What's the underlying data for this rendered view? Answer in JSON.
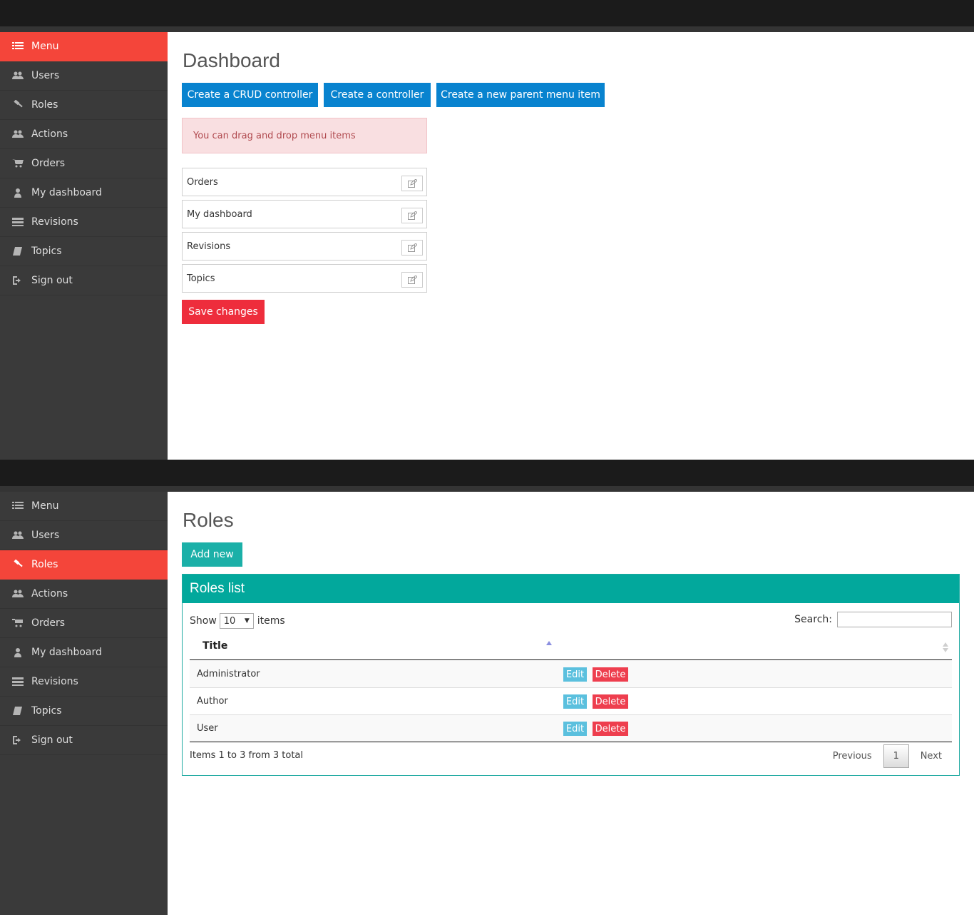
{
  "sidebar": {
    "items": [
      {
        "label": "Menu",
        "icon": "list-icon"
      },
      {
        "label": "Users",
        "icon": "users-icon"
      },
      {
        "label": "Roles",
        "icon": "gavel-icon"
      },
      {
        "label": "Actions",
        "icon": "users-icon"
      },
      {
        "label": "Orders",
        "icon": "cart-icon"
      },
      {
        "label": "My dashboard",
        "icon": "user-icon"
      },
      {
        "label": "Revisions",
        "icon": "tasks-icon"
      },
      {
        "label": "Topics",
        "icon": "book-icon"
      },
      {
        "label": "Sign out",
        "icon": "sign-out-icon"
      }
    ],
    "active_color": "#f4453a",
    "background": "#3a3a3a"
  },
  "dashboard": {
    "title": "Dashboard",
    "buttons": {
      "crud": "Create a CRUD controller",
      "controller": "Create a controller",
      "parent_menu": "Create a new parent menu item"
    },
    "alert": "You can drag and drop menu items",
    "menu_items": [
      "Orders",
      "My dashboard",
      "Revisions",
      "Topics"
    ],
    "save_label": "Save changes"
  },
  "roles": {
    "title": "Roles",
    "add_new": "Add new",
    "list_title": "Roles list",
    "show_label": "Show",
    "show_value": "10",
    "items_label": "items",
    "search_label": "Search:",
    "column_title": "Title",
    "rows": [
      {
        "title": "Administrator",
        "edit": "Edit",
        "delete": "Delete"
      },
      {
        "title": "Author",
        "edit": "Edit",
        "delete": "Delete"
      },
      {
        "title": "User",
        "edit": "Edit",
        "delete": "Delete"
      }
    ],
    "info": "Items 1 to 3 from 3 total",
    "pager": {
      "previous": "Previous",
      "current": "1",
      "next": "Next"
    }
  }
}
